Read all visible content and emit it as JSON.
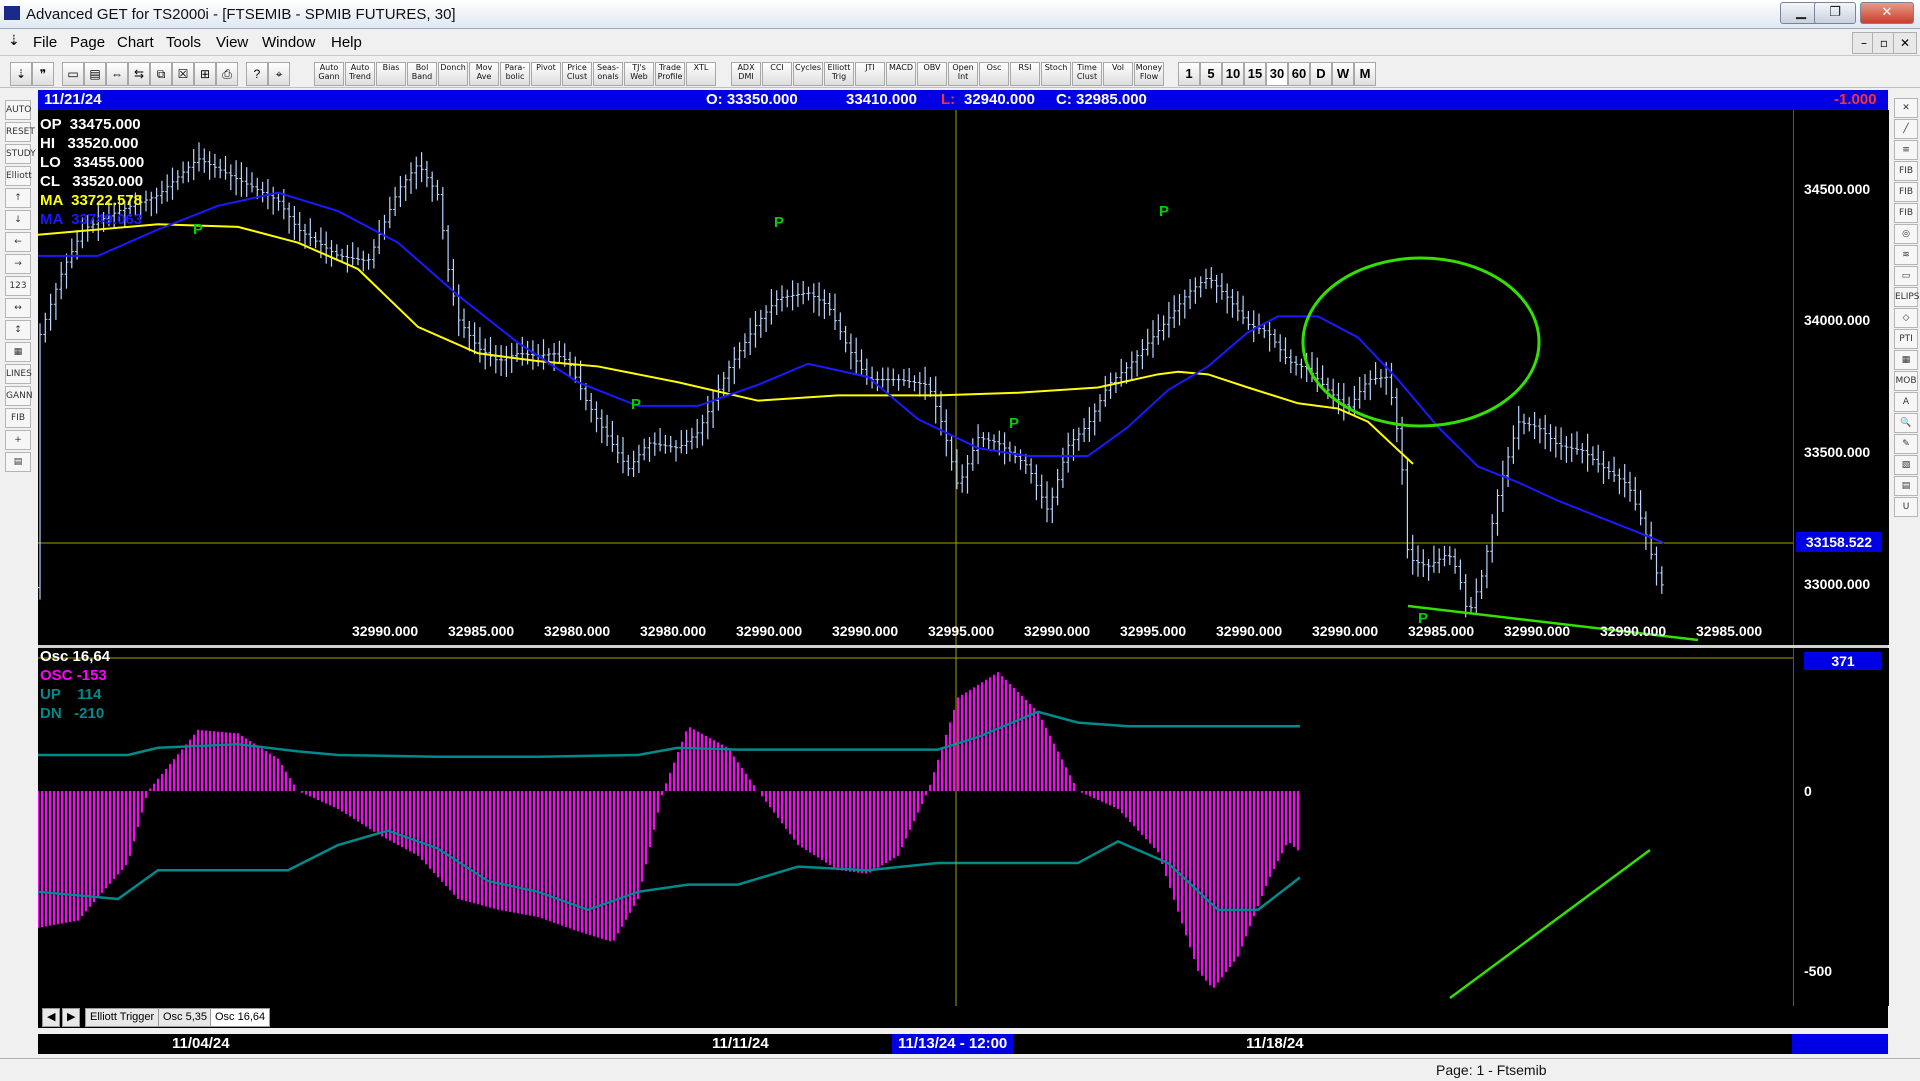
{
  "window": {
    "title": "Advanced GET for TS2000i - [FTSEMIB - SPMIB FUTURES, 30]",
    "min_label": "▁",
    "max_label": "❐",
    "close_label": "✕"
  },
  "menu": [
    "File",
    "Page",
    "Chart",
    "Tools",
    "View",
    "Window",
    "Help"
  ],
  "mdi_buttons": [
    "–",
    "▫",
    "✕"
  ],
  "toolbar_tools": [
    "Auto Gann",
    "Auto Trend",
    "Bias",
    "Bol Band",
    "Donch",
    "Mov Ave",
    "Para- bolic",
    "Pivot",
    "Price Clust",
    "Seas- onals",
    "TJ's Web",
    "Trade Profile",
    "XTL",
    "ADX DMI",
    "CCI",
    "Cycles",
    "Elliott Trig",
    "JTI",
    "MACD",
    "OBV",
    "Open Int",
    "Osc",
    "RSI",
    "Stoch",
    "Time Clust",
    "Vol",
    "Money Flow"
  ],
  "timeframes": [
    "1",
    "5",
    "10",
    "15",
    "30",
    "60",
    "D",
    "W",
    "M"
  ],
  "left_tools": [
    "AUTO",
    "RESET",
    "STUDY",
    "Elliott",
    "↑",
    "↓",
    "←",
    "→",
    "123",
    "↔",
    "↕",
    "▦",
    "LINES",
    "GANN",
    "FIB",
    "+",
    "▤"
  ],
  "right_tools": [
    "✕",
    "╱",
    "≡",
    "FIB RET",
    "FIB EXT",
    "FIB TIME",
    "◎",
    "≋",
    "▭",
    "ELIPS",
    "◇",
    "PTI",
    "▦",
    "MOB",
    "A",
    "🔍",
    "✎",
    "▧",
    "▤",
    "U"
  ],
  "infobar": {
    "date": "11/21/24",
    "open": "O: 33350.000",
    "high": "33410.000",
    "low_label": "L:",
    "low": "32940.000",
    "close": "C: 32985.000",
    "change": "-1.000"
  },
  "price_legend": {
    "op": "OP  33475.000",
    "hi": "HI   33520.000",
    "lo": "LO   33455.000",
    "cl": "CL   33520.000",
    "ma1": "MA  33722.578",
    "ma2": "MA  33749.063"
  },
  "price_axis": [
    "34500.000",
    "34000.000",
    "33500.000",
    "33000.000"
  ],
  "current_price": "33158.522",
  "close_tag": "32985.000",
  "bottom_values": [
    "32990.000",
    "32985.000",
    "32980.000",
    "32980.000",
    "32990.000",
    "32990.000",
    "32995.000",
    "32990.000",
    "32995.000",
    "32990.000",
    "32990.000",
    "32985.000",
    "32990.000",
    "32990.000"
  ],
  "pivot_label": "P",
  "osc_legend": {
    "title": "Osc 16,64",
    "osc": "OSC -153",
    "up": "UP    114",
    "dn": "DN   -210"
  },
  "osc_axis": [
    "0",
    "-500"
  ],
  "osc_value": "371",
  "tabs": [
    "Elliott Trigger",
    "Osc 5,35",
    "Osc 16,64"
  ],
  "dates": [
    "11/04/24",
    "11/11/24",
    "11/13/24 - 12:00",
    "11/18/24"
  ],
  "status": "Page: 1 - Ftsemib",
  "colors": {
    "candle": "#b8d4ff",
    "ma_yellow": "#ffff00",
    "ma_blue": "#1a1aff",
    "pivot": "#00d000",
    "osc": "#ff00ff",
    "band": "#008b8b",
    "cursor": "#a0a000"
  }
}
